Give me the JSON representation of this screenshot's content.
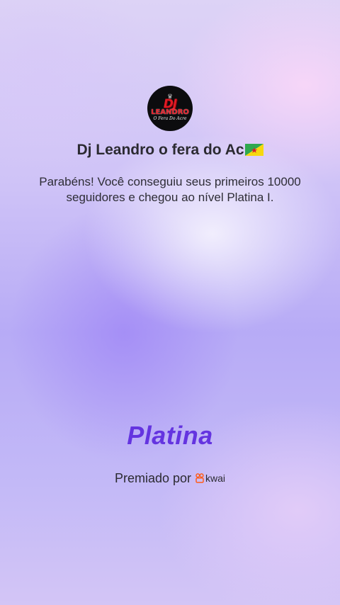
{
  "profile": {
    "avatar_logo_top": "DJ",
    "avatar_logo_mid": "LEANDRO",
    "avatar_logo_sub": "O Fera Do Acre",
    "name": "Dj Leandro o fera do Ac",
    "flag_icon": "french-guiana-flag-icon"
  },
  "message": "Parabéns! Você conseguiu seus primeiros 10000 seguidores e chegou ao nível Platina I.",
  "level": "Platina",
  "award": {
    "prefix": "Premiado por",
    "brand": "kwai",
    "brand_icon": "kwai-logo-icon"
  },
  "colors": {
    "level_purple": "#6434e0",
    "brand_orange": "#ff5c1a"
  }
}
